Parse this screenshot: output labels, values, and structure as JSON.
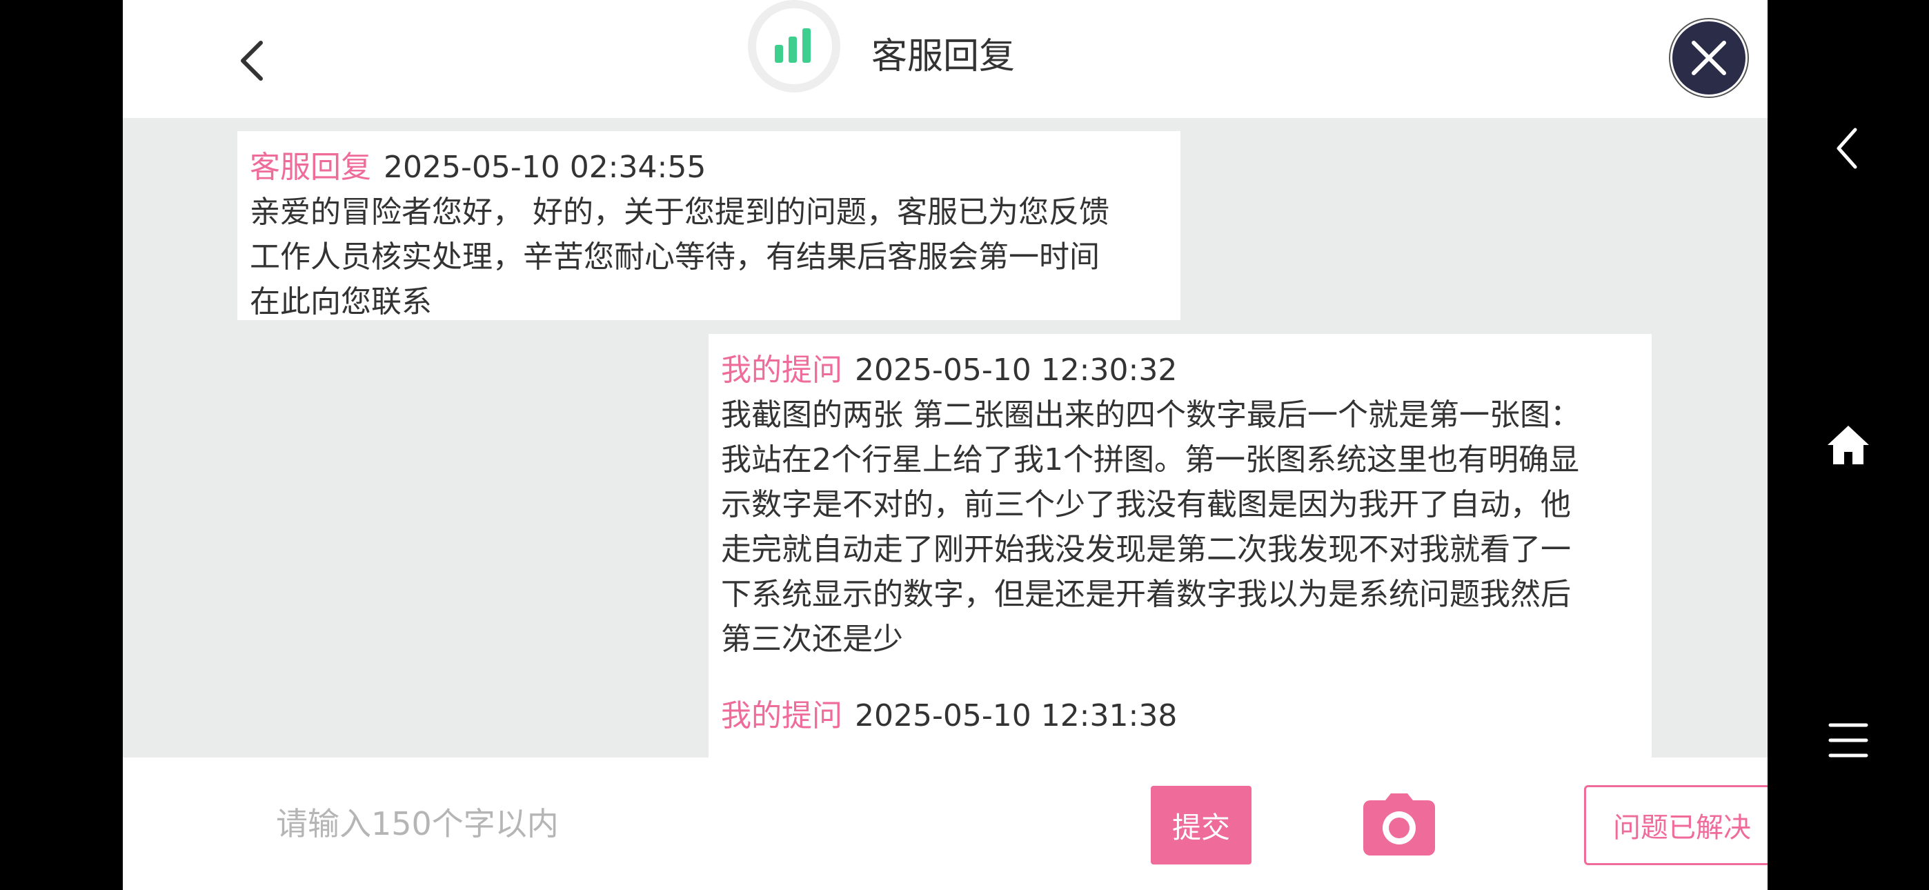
{
  "header": {
    "title": "客服回复"
  },
  "messages": [
    {
      "sender": "客服回复",
      "time": "2025-05-10 02:34:55",
      "lines": [
        "亲爱的冒险者您好， 好的，关于您提到的问题，客服已为您反馈",
        "工作人员核实处理，辛苦您耐心等待，有结果后客服会第一时间",
        "在此向您联系"
      ]
    },
    {
      "sender": "我的提问",
      "time": "2025-05-10 12:30:32",
      "lines": [
        "我截图的两张 第二张圈出来的四个数字最后一个就是第一张图：",
        "我站在2个行星上给了我1个拼图。第一张图系统这里也有明确显",
        "示数字是不对的，前三个少了我没有截图是因为我开了自动，他",
        "走完就自动走了刚开始我没发现是第二次我发现不对我就看了一",
        "下系统显示的数字，但是还是开着数字我以为是系统问题我然后",
        "第三次还是少"
      ]
    },
    {
      "sender": "我的提问",
      "time": "2025-05-10 12:31:38",
      "lines": []
    }
  ],
  "input": {
    "placeholder": "请输入150个字以内",
    "value": ""
  },
  "actions": {
    "submit_label": "提交",
    "resolved_label": "问题已解决"
  },
  "colors": {
    "accent": "#ee6b9a",
    "chat_bg": "#e9ecea",
    "close_bg": "#2b2d48",
    "signal_green": "#3ecf8e"
  },
  "icons": {
    "back": "chevron-left-icon",
    "signal": "signal-bars-icon",
    "close": "close-icon",
    "camera": "camera-icon",
    "nav_back": "nav-back-icon",
    "nav_home": "nav-home-icon",
    "nav_menu": "nav-menu-icon"
  }
}
